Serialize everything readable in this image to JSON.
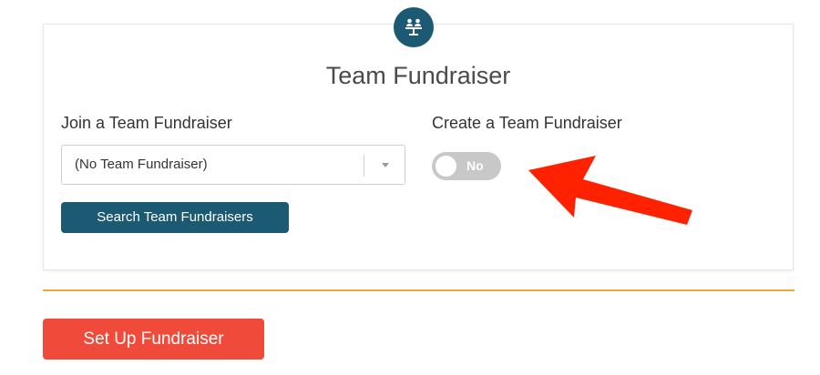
{
  "card": {
    "title": "Team Fundraiser",
    "icon": "team-group-icon"
  },
  "join": {
    "label": "Join a Team Fundraiser",
    "select_value": "(No Team Fundraiser)",
    "search_button_label": "Search Team Fundraisers"
  },
  "create": {
    "label": "Create a Team Fundraiser",
    "toggle_state": "No"
  },
  "footer": {
    "setup_button_label": "Set Up Fundraiser"
  },
  "colors": {
    "primary": "#1c5a73",
    "accent_divider": "#f0a83a",
    "cta": "#ef4a3a",
    "toggle_off": "#c8c8c8",
    "annotation_arrow": "#ff2200"
  }
}
